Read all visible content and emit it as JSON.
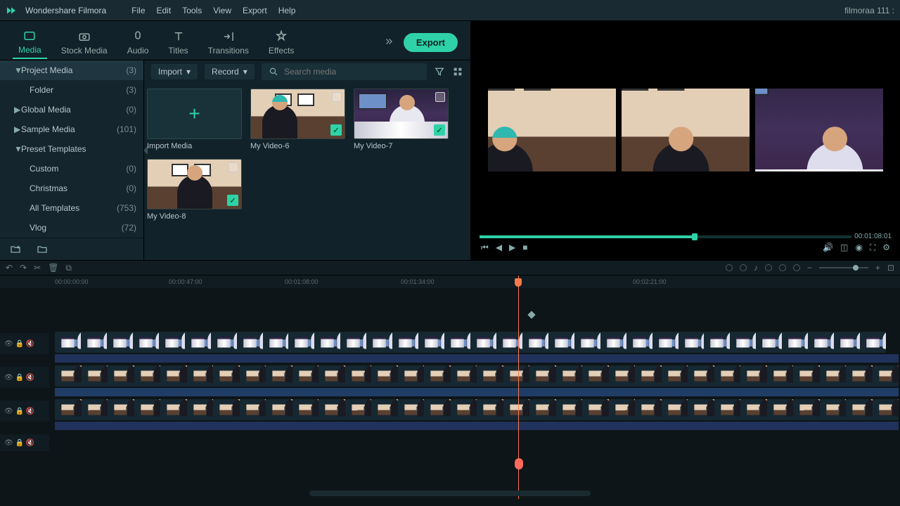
{
  "app": {
    "name": "Wondershare Filmora",
    "project": "filmoraa 111 :"
  },
  "menu": {
    "file": "File",
    "edit": "Edit",
    "tools": "Tools",
    "view": "View",
    "export": "Export",
    "help": "Help"
  },
  "tabs": {
    "media": "Media",
    "stock": "Stock Media",
    "audio": "Audio",
    "titles": "Titles",
    "transitions": "Transitions",
    "effects": "Effects"
  },
  "export_btn": "Export",
  "sidebar": {
    "project_media": {
      "label": "Project Media",
      "count": "(3)"
    },
    "folder": {
      "label": "Folder",
      "count": "(3)"
    },
    "global_media": {
      "label": "Global Media",
      "count": "(0)"
    },
    "sample_media": {
      "label": "Sample Media",
      "count": "(101)"
    },
    "preset_templates": {
      "label": "Preset Templates"
    },
    "custom": {
      "label": "Custom",
      "count": "(0)"
    },
    "christmas": {
      "label": "Christmas",
      "count": "(0)"
    },
    "all_templates": {
      "label": "All Templates",
      "count": "(753)"
    },
    "vlog": {
      "label": "Vlog",
      "count": "(72)"
    }
  },
  "mediabar": {
    "import": "Import",
    "record": "Record",
    "search_placeholder": "Search media"
  },
  "thumbs": {
    "import": "Import Media",
    "v6": "My Video-6",
    "v7": "My Video-7",
    "v8": "My Video-8"
  },
  "preview": {
    "timecode": "00:01:08:01"
  },
  "ruler": {
    "t0": "00:00:00:00",
    "t1": "00:00:47:00",
    "t2": "00:01:08:00",
    "t3": "00:01:34:00",
    "t4": "00:02:21:00"
  }
}
